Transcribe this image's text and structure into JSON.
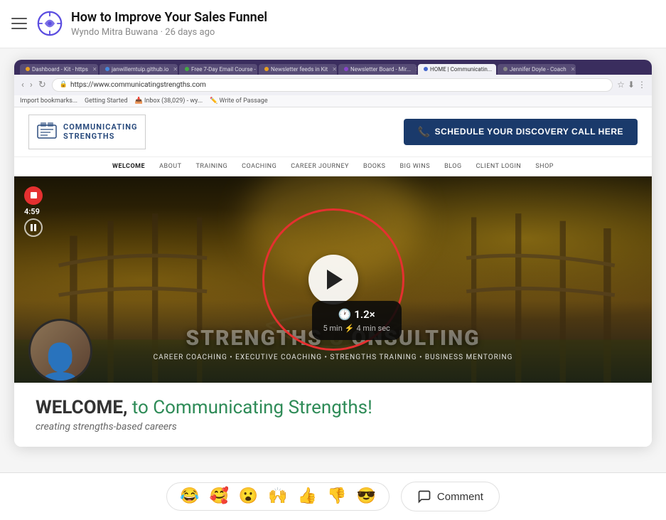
{
  "app": {
    "hamburger_label": "menu",
    "logo_aria": "app-logo"
  },
  "post": {
    "title": "How to Improve Your Sales Funnel",
    "author": "Wyndo Mitra Buwana",
    "time_ago": "26 days ago"
  },
  "browser": {
    "tabs": [
      {
        "label": "Dashboard - Kit - https...",
        "color": "#e8a020",
        "active": false
      },
      {
        "label": "janwillemtuip.github.io",
        "color": "#4488dd",
        "active": false
      },
      {
        "label": "Free 7-Day Email Course -",
        "color": "#44aa44",
        "active": false
      },
      {
        "label": "Newsletter feeds in Kit",
        "color": "#e8a020",
        "active": false
      },
      {
        "label": "Newsletter Board - Mir...",
        "color": "#8844cc",
        "active": false
      },
      {
        "label": "HOME | Communicatin...",
        "color": "#4466cc",
        "active": true
      },
      {
        "label": "Jennifer Doyle - Coach...",
        "color": "#888",
        "active": false
      }
    ],
    "url": "https://www.communicatingstrengths.com",
    "bookmarks": [
      "Import bookmarks...",
      "Getting Started",
      "Inbox (38,029) - wy...",
      "Write of Passage"
    ]
  },
  "site": {
    "logo_line1": "COMMUNICATING",
    "logo_line2": "STRENGTHS",
    "schedule_btn": "SCHEDULE YOUR DISCOVERY CALL HERE",
    "nav_items": [
      {
        "label": "WELCOME",
        "active": true
      },
      {
        "label": "ABOUT",
        "active": false
      },
      {
        "label": "TRAINING",
        "active": false
      },
      {
        "label": "COACHING",
        "active": false
      },
      {
        "label": "CAREER JOURNEY",
        "active": false
      },
      {
        "label": "BOOKS",
        "active": false
      },
      {
        "label": "BIG WINS",
        "active": false
      },
      {
        "label": "BLOG",
        "active": false
      },
      {
        "label": "CLIENT LOGIN",
        "active": false
      },
      {
        "label": "SHOP",
        "active": false
      }
    ]
  },
  "hero": {
    "timer": "4:59",
    "title_left": "STRENGTHS",
    "title_right": "ONSULTING",
    "title_center_gap": "C",
    "subtitle": "CAREER COACHING  •  EXECUTIVE COACHING  •  STRENGTHS TRAINING  •  BUSINESS MENTORING",
    "play_aria": "play button"
  },
  "speed_popup": {
    "clock_icon": "🕐",
    "speed": "1.2×",
    "original_label": "5 min",
    "lightning": "⚡",
    "fast_label": "4 min sec"
  },
  "welcome": {
    "text_prefix": "WELCOME,",
    "text_suffix": "to Communicating Strengths!",
    "subtext": "creating strengths-based careers"
  },
  "reactions": [
    {
      "emoji": "😂",
      "label": "laugh"
    },
    {
      "emoji": "🥰",
      "label": "love"
    },
    {
      "emoji": "😮",
      "label": "wow"
    },
    {
      "emoji": "🙌",
      "label": "clap"
    },
    {
      "emoji": "👍",
      "label": "thumbsup"
    },
    {
      "emoji": "👎",
      "label": "thumbsdown"
    },
    {
      "emoji": "😎",
      "label": "cool"
    }
  ],
  "comment_btn": {
    "label": "Comment",
    "icon": "comment-icon"
  }
}
